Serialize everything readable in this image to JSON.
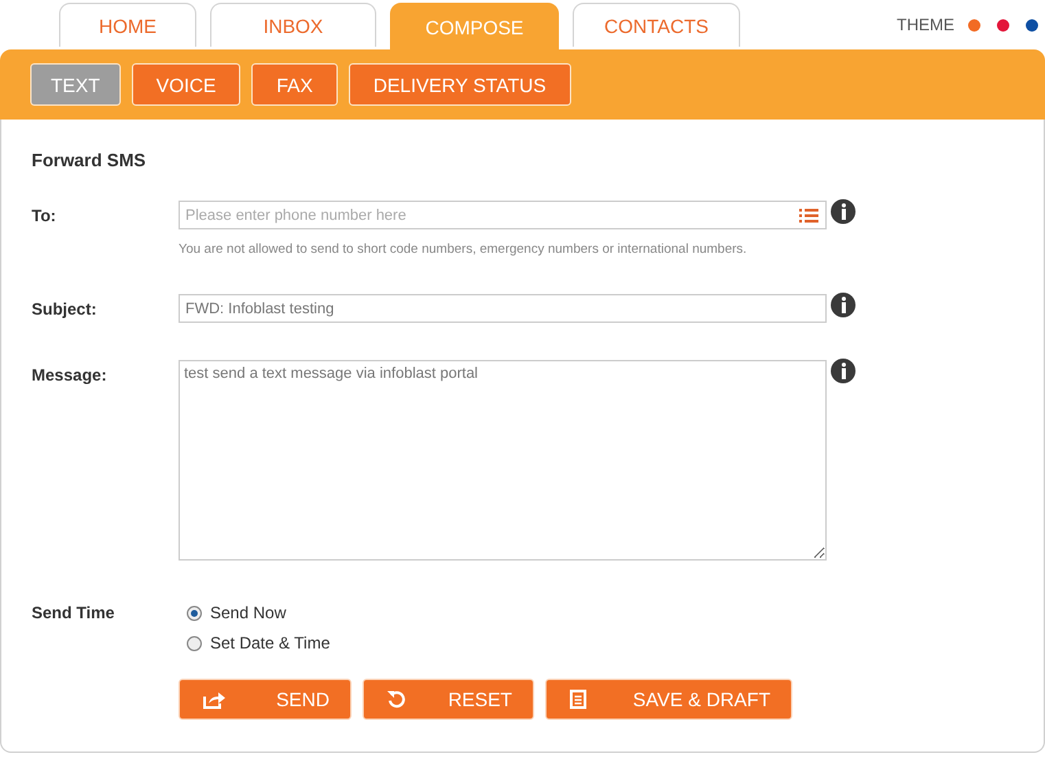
{
  "tabs": [
    {
      "label": "HOME",
      "selected": false
    },
    {
      "label": "INBOX",
      "selected": false
    },
    {
      "label": "COMPOSE",
      "selected": true
    },
    {
      "label": "CONTACTS",
      "selected": false
    }
  ],
  "theme": {
    "label": "THEME",
    "options": [
      {
        "color": "#f26b24"
      },
      {
        "color": "#e3163a"
      },
      {
        "color": "#0e4fa3"
      }
    ]
  },
  "subtabs": [
    {
      "label": "TEXT",
      "selected": true
    },
    {
      "label": "VOICE",
      "selected": false
    },
    {
      "label": "FAX",
      "selected": false
    },
    {
      "label": "DELIVERY STATUS",
      "selected": false
    }
  ],
  "form": {
    "title": "Forward SMS",
    "to": {
      "label": "To:",
      "placeholder": "Please enter phone number here",
      "note": "You are not allowed to send to short code numbers, emergency numbers or international numbers."
    },
    "subject": {
      "label": "Subject:",
      "value": "FWD: Infoblast testing"
    },
    "message": {
      "label": "Message:",
      "value": "test send a text message via infoblast portal"
    },
    "send_time": {
      "label": "Send Time",
      "options": [
        {
          "label": "Send Now",
          "selected": true
        },
        {
          "label": "Set Date & Time",
          "selected": false
        }
      ]
    },
    "buttons": [
      {
        "label": "SEND",
        "kind": "send"
      },
      {
        "label": "RESET",
        "kind": "reset"
      },
      {
        "label": "SAVE & DRAFT",
        "kind": "save"
      }
    ]
  }
}
